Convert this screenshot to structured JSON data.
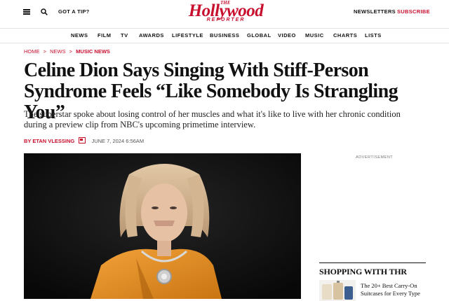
{
  "header": {
    "tip_label": "GOT A TIP?",
    "logo_the": "THE",
    "logo_main": "Hollywood",
    "logo_sub": "REPORTER",
    "newsletters_label": "NEWSLETTERS",
    "subscribe_label": "SUBSCRIBE"
  },
  "nav": {
    "items": [
      "NEWS",
      "FILM",
      "TV",
      "AWARDS",
      "LIFESTYLE",
      "BUSINESS",
      "GLOBAL",
      "VIDEO",
      "MUSIC",
      "CHARTS",
      "LISTS"
    ]
  },
  "breadcrumb": {
    "items": [
      "HOME",
      "NEWS",
      "MUSIC NEWS"
    ],
    "separator": ">"
  },
  "article": {
    "headline": "Celine Dion Says Singing With Stiff-Person Syndrome Feels “Like Somebody Is Strangling You”",
    "dek": "The superstar spoke about losing control of her muscles and what it's like to live with her chronic condition during a preview clip from NBC's upcoming primetime interview.",
    "byline_author": "BY ETAN VLESSING",
    "date": "JUNE 7, 2024 6:56AM"
  },
  "sidebar": {
    "ad_label": "ADVERTISEMENT",
    "shopping_title": "SHOPPING WITH THR",
    "shopping_item": "The 20+ Best Carry-On Suitcases for Every Type"
  },
  "colors": {
    "brand": "#c8102e",
    "text": "#111111"
  }
}
